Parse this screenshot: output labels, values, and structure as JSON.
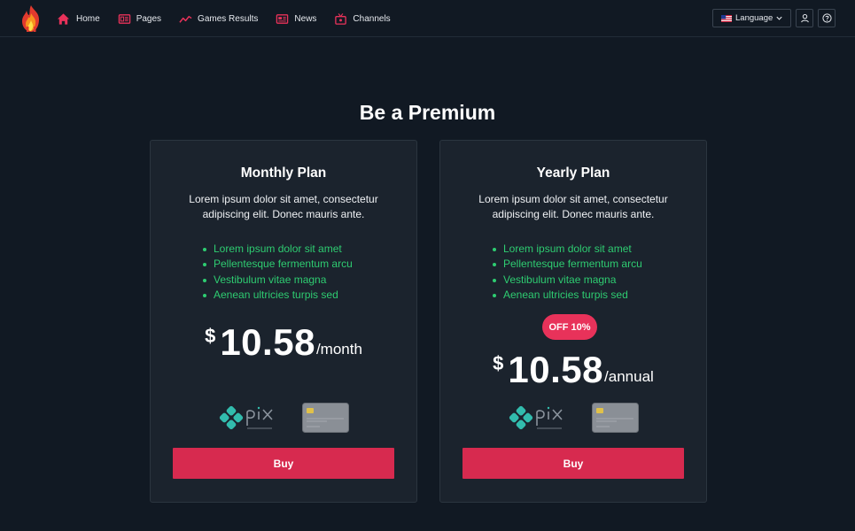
{
  "nav": {
    "items": [
      {
        "label": "Home",
        "icon": "home-icon"
      },
      {
        "label": "Pages",
        "icon": "pages-icon"
      },
      {
        "label": "Games Results",
        "icon": "chart-line-icon"
      },
      {
        "label": "News",
        "icon": "newspaper-icon"
      },
      {
        "label": "Channels",
        "icon": "tv-icon"
      }
    ],
    "language_label": "Language",
    "language_flag": "us-flag-icon",
    "user_icon": "user-icon",
    "help_icon": "help-circle-icon"
  },
  "page": {
    "title": "Be a Premium"
  },
  "plans": [
    {
      "title": "Monthly Plan",
      "description": "Lorem ipsum dolor sit amet, consectetur adipiscing elit. Donec mauris ante.",
      "features": [
        "Lorem ipsum dolor sit amet",
        "Pellentesque fermentum arcu",
        "Vestibulum vitae magna",
        "Aenean ultricies turpis sed"
      ],
      "currency": "$",
      "price": "10.58",
      "period": "/month",
      "badge": "",
      "payment_methods": [
        "pix-logo-icon",
        "credit-card-icon"
      ],
      "buy_label": "Buy"
    },
    {
      "title": "Yearly Plan",
      "description": "Lorem ipsum dolor sit amet, consectetur adipiscing elit. Donec mauris ante.",
      "features": [
        "Lorem ipsum dolor sit amet",
        "Pellentesque fermentum arcu",
        "Vestibulum vitae magna",
        "Aenean ultricies turpis sed"
      ],
      "currency": "$",
      "price": "10.58",
      "period": "/annual",
      "badge": "OFF 10%",
      "payment_methods": [
        "pix-logo-icon",
        "credit-card-icon"
      ],
      "buy_label": "Buy"
    }
  ],
  "colors": {
    "background": "#111923",
    "card_background": "#1b232d",
    "accent": "#d72a4f",
    "badge": "#e8325a",
    "feature_text": "#2ecc71",
    "pix": "#32bcad"
  }
}
